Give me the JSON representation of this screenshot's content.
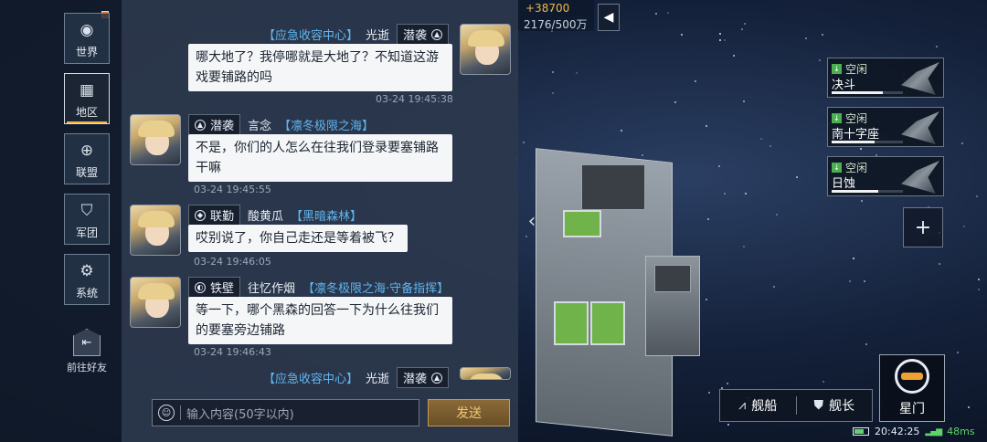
{
  "top": {
    "gold": "+38700",
    "capacity": "2176/500万",
    "collapse_icon": "triangle-left-icon"
  },
  "nav": {
    "items": [
      {
        "label": "世界",
        "icon": "planet-icon"
      },
      {
        "label": "地区",
        "icon": "region-icon"
      },
      {
        "label": "联盟",
        "icon": "globe-icon"
      },
      {
        "label": "军团",
        "icon": "shield-icon"
      },
      {
        "label": "系统",
        "icon": "gear-icon"
      }
    ],
    "friend_label": "前往好友",
    "friend_icon": "person-arrow-icon"
  },
  "chat": {
    "messages": [
      {
        "rank": "潜袭",
        "name": "光逝",
        "guild": "【应急收容中心】",
        "text_lines": [
          "哪大地了？我停哪就是大地了？不知道这游",
          "戏要铺路的吗"
        ],
        "time": "03-24 19:45:38",
        "side": "right"
      },
      {
        "rank": "潜袭",
        "name": "言念",
        "guild": "【凛冬极限之海】",
        "text_lines": [
          "不是，你们的人怎么在往我们登录要塞铺路",
          "干嘛"
        ],
        "time": "03-24 19:45:55",
        "side": "left"
      },
      {
        "rank": "联勤",
        "name": "酸黄瓜",
        "guild": "【黑暗森林】",
        "text_lines": [
          "哎别说了，你自己走还是等着被飞？"
        ],
        "time": "03-24 19:46:05",
        "side": "left"
      },
      {
        "rank": "铁壁",
        "name": "往忆作烟",
        "guild": "【凛冬极限之海·守备指挥】",
        "text_lines": [
          "等一下，哪个黑森的回答一下为什么往我们",
          "的要塞旁边铺路"
        ],
        "time": "03-24 19:46:43",
        "side": "left"
      },
      {
        "rank": "潜袭",
        "name": "光逝",
        "guild": "【应急收容中心】",
        "side": "right"
      }
    ],
    "input_placeholder": "输入内容(50字以内)",
    "send_label": "发送"
  },
  "fleets": [
    {
      "status": "空闲",
      "name": "决斗",
      "health": 0.72
    },
    {
      "status": "空闲",
      "name": "南十字座",
      "health": 0.6
    },
    {
      "status": "空闲",
      "name": "日蚀",
      "health": 0.65
    }
  ],
  "bottom": {
    "ship_label": "舰船",
    "captain_label": "舰长",
    "stargate_label": "星门"
  },
  "status": {
    "time": "20:42:25",
    "ping": "48ms",
    "battery": 0.7
  },
  "colors": {
    "accent": "#f0b84a",
    "guild": "#5fb6f0",
    "idle": "#4caf50"
  }
}
